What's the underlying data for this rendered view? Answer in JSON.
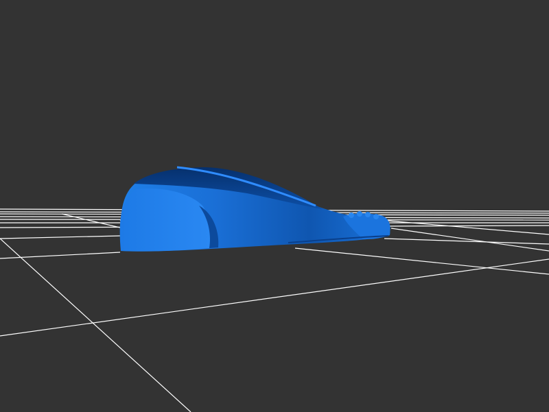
{
  "scene": {
    "background_color": "#333333",
    "grid_color": "#ffffff",
    "model_color": "#1a75e0",
    "model_highlight_color": "#2f8cff",
    "model_shadow_color": "#0a3f8a",
    "grid_visible": true,
    "model_icon": "3d-mesh-model"
  }
}
